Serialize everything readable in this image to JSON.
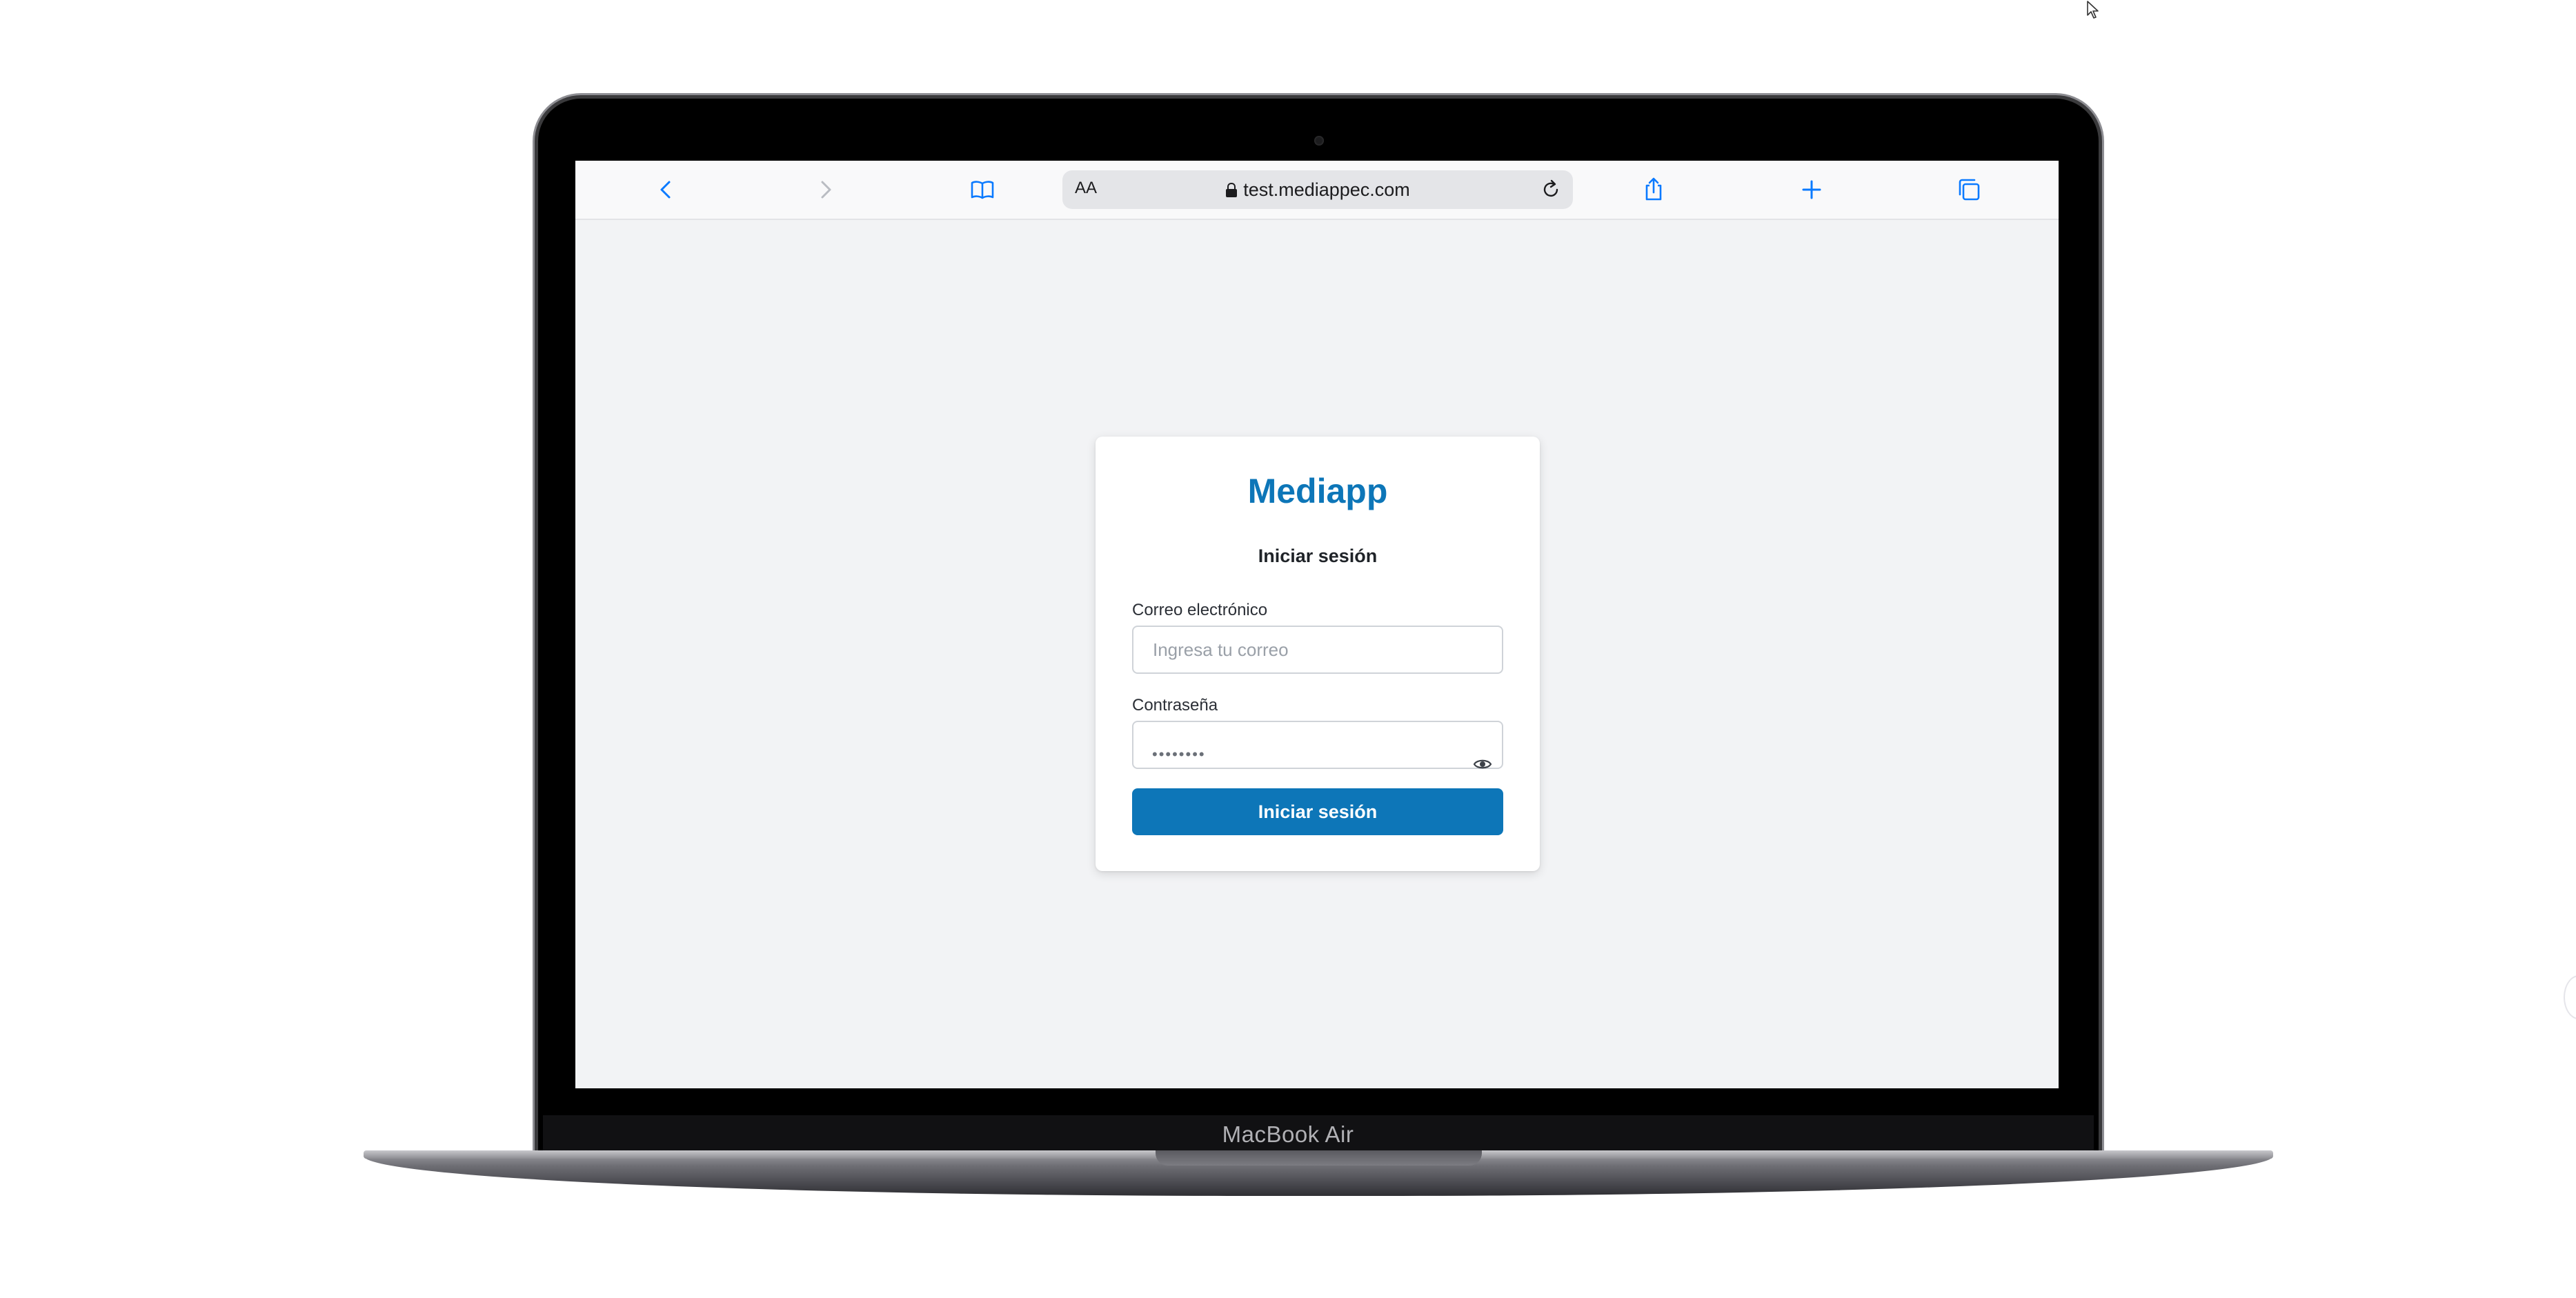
{
  "device": {
    "label": "MacBook Air"
  },
  "browser": {
    "text_size_label": "AA",
    "url": "test.mediappec.com",
    "icons": [
      "chevron-left-icon",
      "chevron-right-icon",
      "bookmarks-icon",
      "lock-icon",
      "reload-icon",
      "share-icon",
      "plus-icon",
      "tabs-icon"
    ]
  },
  "login": {
    "brand": "Mediapp",
    "title": "Iniciar sesión",
    "email_label": "Correo electrónico",
    "email_placeholder": "Ingresa tu correo",
    "email_value": "",
    "password_label": "Contraseña",
    "password_value": "••••••••",
    "submit_label": "Iniciar sesión"
  },
  "colors": {
    "brand": "#0d76b8",
    "safari_accent": "#0a7aff",
    "page_bg": "#f2f3f5"
  }
}
